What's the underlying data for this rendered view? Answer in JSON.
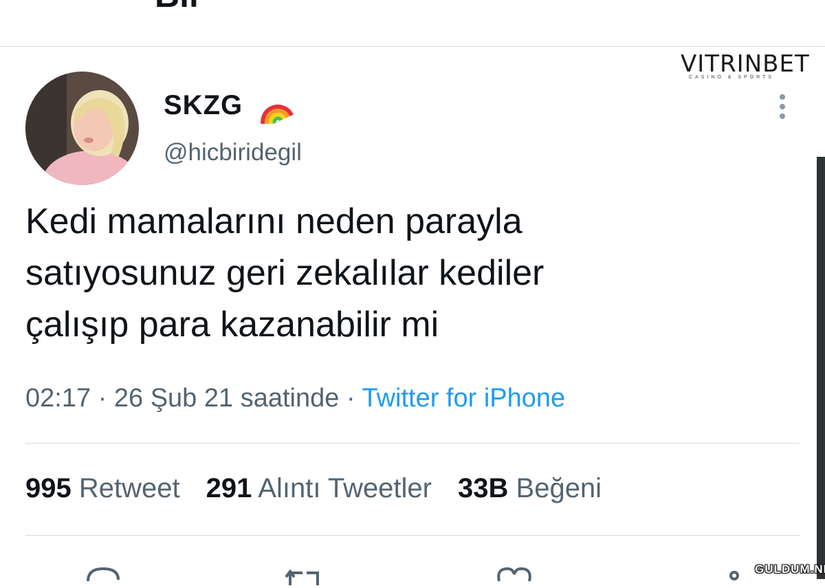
{
  "header": {
    "title": "Bil"
  },
  "brand_logo": {
    "name": "VITRINBET",
    "tagline": "CASINO & SPORTS"
  },
  "author": {
    "display_name": "SKZG",
    "name_emoji": "🌈",
    "handle": "@hicbiridegil"
  },
  "tweet": {
    "lines": [
      "Kedi mamalarını neden parayla",
      "satıyosunuz geri zekalılar kediler",
      "çalışıp para kazanabilir mi"
    ],
    "time": "02:17",
    "date_text": "26 Şub 21 saatinde",
    "separator": "·",
    "source": "Twitter for iPhone"
  },
  "stats": {
    "retweets": {
      "count": "995",
      "label": "Retweet"
    },
    "quotes": {
      "count": "291",
      "label": "Alıntı Tweetler"
    },
    "likes": {
      "count": "33B",
      "label": "Beğeni"
    }
  },
  "actions": [
    "reply-icon",
    "retweet-icon",
    "like-icon",
    "share-icon"
  ],
  "watermark": "GULDUM.NET",
  "colors": {
    "accent": "#1d9bf0",
    "secondary_text": "#536471",
    "divider": "#d6d9dc"
  }
}
